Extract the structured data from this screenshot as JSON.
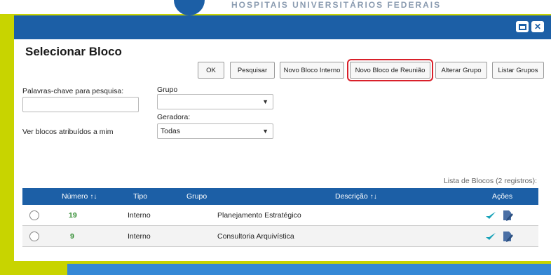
{
  "header": {
    "banner_text": "HOSPITAIS UNIVERSITÁRIOS FEDERAIS"
  },
  "page": {
    "title": "Selecionar Bloco"
  },
  "toolbar": {
    "ok": "OK",
    "pesquisar": "Pesquisar",
    "novo_bloco_interno": "Novo Bloco Interno",
    "novo_bloco_reuniao": "Novo Bloco de Reunião",
    "alterar_grupo": "Alterar Grupo",
    "listar_grupos": "Listar Grupos"
  },
  "filters": {
    "keywords_label": "Palavras-chave para pesquisa:",
    "keywords_value": "",
    "grupo_label": "Grupo",
    "grupo_value": "",
    "geradora_label": "Geradora:",
    "geradora_value": "Todas",
    "ver_blocos_label": "Ver blocos atribuídos a mim"
  },
  "list": {
    "records_label": "Lista de Blocos (2 registros):",
    "columns": {
      "numero": "Número",
      "tipo": "Tipo",
      "grupo": "Grupo",
      "descricao": "Descrição",
      "acoes": "Ações"
    },
    "rows": [
      {
        "numero": "19",
        "tipo": "Interno",
        "grupo": "",
        "descricao": "Planejamento Estratégico"
      },
      {
        "numero": "9",
        "tipo": "Interno",
        "grupo": "",
        "descricao": "Consultoria Arquivística"
      }
    ]
  },
  "colors": {
    "primary": "#1c5fa6",
    "accent_yellow": "#c8d400",
    "highlight_red": "#d9202a",
    "number_green": "#2e8b2e",
    "action_teal": "#17a2b8"
  },
  "icons": {
    "maximize": "maximize-icon",
    "close": "close-icon",
    "sort": "sort-arrows-icon",
    "chevron": "chevron-down-icon",
    "check_action": "check-arrow-icon",
    "edit_action": "edit-document-icon"
  }
}
